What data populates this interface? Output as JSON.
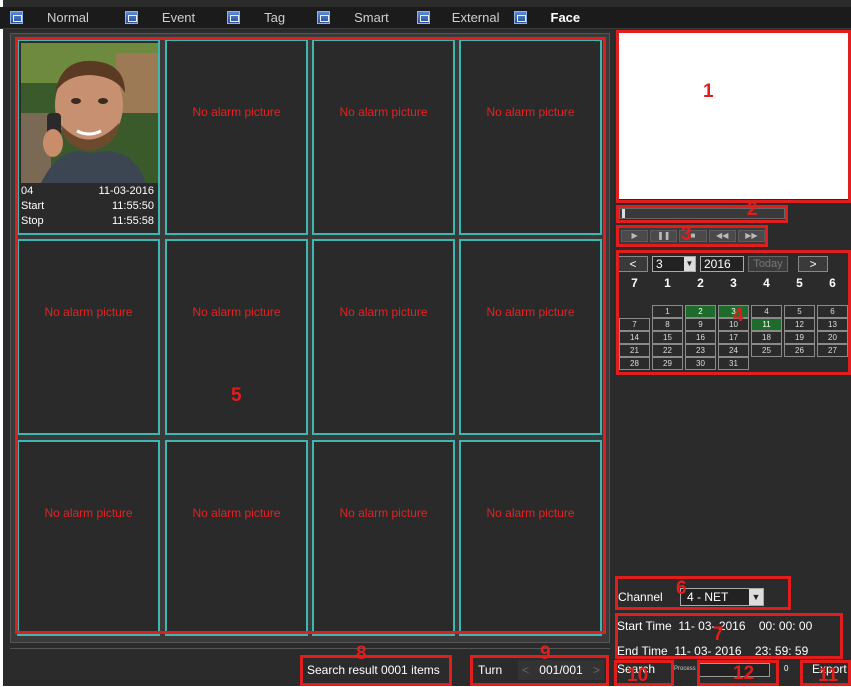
{
  "tabs": [
    {
      "label": "Normal",
      "icon": "normal-tab-icon"
    },
    {
      "label": "Event",
      "icon": "event-tab-icon"
    },
    {
      "label": "Tag",
      "icon": "tag-tab-icon"
    },
    {
      "label": "Smart",
      "icon": "smart-tab-icon"
    },
    {
      "label": "External",
      "icon": "external-tab-icon"
    },
    {
      "label": "Face",
      "icon": "face-tab-icon",
      "active": true
    }
  ],
  "first_cell": {
    "channel": "04",
    "date": "11-03-2016",
    "start_label": "Start",
    "start_time": "11:55:50",
    "stop_label": "Stop",
    "stop_time": "11:55:58"
  },
  "no_alarm_text": "No alarm picture",
  "calendar": {
    "month": "3",
    "year": "2016",
    "today_label": "Today",
    "prev": "<",
    "next": ">",
    "dow": [
      "7",
      "1",
      "2",
      "3",
      "4",
      "5",
      "6"
    ],
    "days": [
      "",
      "",
      "",
      "",
      "",
      "",
      "",
      "",
      "1",
      "2",
      "3",
      "4",
      "5",
      "6",
      "7",
      "8",
      "9",
      "10",
      "11",
      "12",
      "13",
      "14",
      "15",
      "16",
      "17",
      "18",
      "19",
      "20",
      "21",
      "22",
      "23",
      "24",
      "25",
      "26",
      "27",
      "28",
      "29",
      "30",
      "31"
    ],
    "highlighted": [
      "2",
      "3",
      "11"
    ]
  },
  "channel": {
    "label": "Channel",
    "value": "4 - NET"
  },
  "start_time": {
    "label": "Start Time",
    "date": "11- 03- 2016",
    "time": "00: 00: 00"
  },
  "end_time": {
    "label": "End Time",
    "date": "11- 03- 2016",
    "time": "23: 59: 59"
  },
  "search_result": "Search result  0001 items",
  "turn": {
    "label": "Turn",
    "page": "001/001",
    "prev": "<",
    "next": ">"
  },
  "buttons": {
    "search": "Search",
    "export": "Export"
  },
  "process": {
    "label": "Process",
    "value": "0"
  },
  "annotations": [
    "1",
    "2",
    "3",
    "4",
    "5",
    "6",
    "7",
    "8",
    "9",
    "10",
    "11",
    "12"
  ],
  "colors": {
    "annotation": "#e01e1e",
    "cell_border": "#3fb6b0",
    "no_alarm": "#e02424"
  }
}
